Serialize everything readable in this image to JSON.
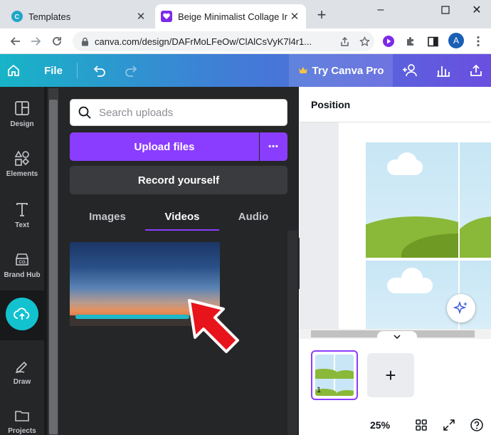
{
  "browser": {
    "tabs": [
      {
        "title": "Templates",
        "close": "✕"
      },
      {
        "title": "Beige Minimalist Collage Ins",
        "close": "✕"
      }
    ],
    "new_tab": "+",
    "window": {
      "minimize": "–",
      "maximize": "☐",
      "close": "✕"
    },
    "url": "canva.com/design/DAFrMoLFeOw/ClAlCsVyK7l4r1...",
    "profile_initial": "A"
  },
  "canva_header": {
    "file_label": "File",
    "try_pro_label": "Try Canva Pro",
    "brand_color": "#8b3dff"
  },
  "rail": {
    "items": [
      {
        "label": "Design",
        "icon": "layout-icon"
      },
      {
        "label": "Elements",
        "icon": "shapes-icon"
      },
      {
        "label": "Text",
        "icon": "text-icon"
      },
      {
        "label": "Brand Hub",
        "icon": "brand-icon"
      },
      {
        "label": "",
        "icon": "upload-cloud-icon"
      },
      {
        "label": "Draw",
        "icon": "pen-icon"
      },
      {
        "label": "Projects",
        "icon": "folder-icon"
      }
    ]
  },
  "panel": {
    "search_placeholder": "Search uploads",
    "upload_label": "Upload files",
    "more_label": "•••",
    "record_label": "Record yourself",
    "tabs": [
      "Images",
      "Videos",
      "Audio"
    ],
    "active_tab": "Videos"
  },
  "editor": {
    "position_label": "Position",
    "page_number": "1",
    "add_page": "+",
    "zoom": "25%"
  }
}
